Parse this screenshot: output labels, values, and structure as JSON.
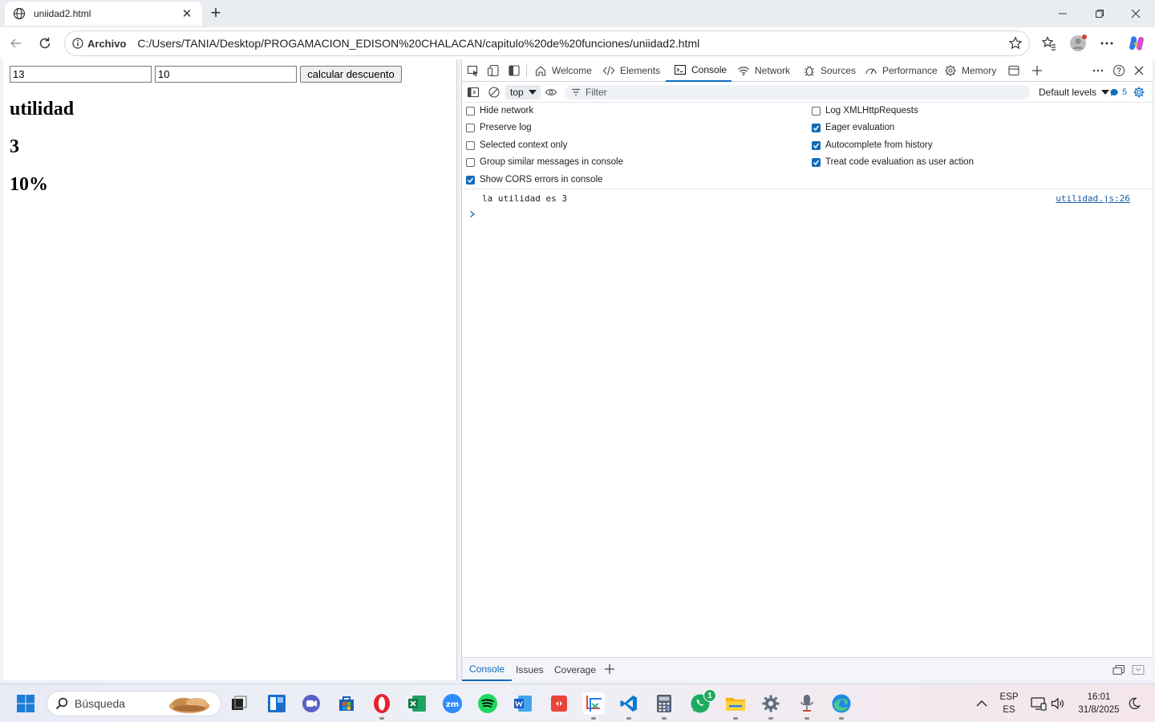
{
  "browser": {
    "tab_title": "uniidad2.html",
    "scheme_label": "Archivo",
    "url": "C:/Users/TANIA/Desktop/PROGAMACION_EDISON%20CHALACAN/capitulo%20de%20funciones/uniidad2.html"
  },
  "page": {
    "input1_value": "13",
    "input2_value": "10",
    "button_label": "calcular descuento",
    "heading": "utilidad",
    "result_value": "3",
    "percent_value": "10%"
  },
  "devtools": {
    "tabs": [
      "Welcome",
      "Elements",
      "Console",
      "Network",
      "Sources",
      "Performance",
      "Memory"
    ],
    "active_tab": "Console",
    "context": "top",
    "filter_placeholder": "Filter",
    "levels": "Default levels",
    "message_count": "5",
    "settings": {
      "left": [
        {
          "label": "Hide network",
          "checked": false
        },
        {
          "label": "Preserve log",
          "checked": false
        },
        {
          "label": "Selected context only",
          "checked": false
        },
        {
          "label": "Group similar messages in console",
          "checked": false
        },
        {
          "label": "Show CORS errors in console",
          "checked": true
        }
      ],
      "right": [
        {
          "label": "Log XMLHttpRequests",
          "checked": false
        },
        {
          "label": "Eager evaluation",
          "checked": true
        },
        {
          "label": "Autocomplete from history",
          "checked": true
        },
        {
          "label": "Treat code evaluation as user action",
          "checked": true
        }
      ]
    },
    "console_message": "la utilidad es 3",
    "console_source": "utilidad.js:26",
    "drawer_tabs": [
      "Console",
      "Issues",
      "Coverage"
    ]
  },
  "taskbar": {
    "search_placeholder": "Búsqueda",
    "whatsapp_badge": "1",
    "lang_top": "ESP",
    "lang_bottom": "ES",
    "time": "16:01",
    "date": "31/8/2025"
  },
  "colors": {
    "accent": "#0f6cbd",
    "checkbox_on": "#0f6cbd",
    "link": "#1a5fa6"
  }
}
